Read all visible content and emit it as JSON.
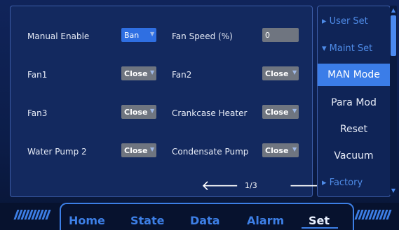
{
  "main": {
    "rows": [
      {
        "left_label": "Manual Enable",
        "left_value": "Ban",
        "right_label": "Fan Speed (%)",
        "right_value": "0"
      },
      {
        "left_label": "Fan1",
        "left_value": "Close",
        "right_label": "Fan2",
        "right_value": "Close"
      },
      {
        "left_label": "Fan3",
        "left_value": "Close",
        "right_label": "Crankcase Heater",
        "right_value": "Close"
      },
      {
        "left_label": "Water Pump 2",
        "left_value": "Close",
        "right_label": "Condensate Pump",
        "right_value": "Close"
      }
    ],
    "pager": {
      "indicator": "1/3"
    }
  },
  "side_menu": {
    "items": [
      {
        "label": "▸ User Set"
      },
      {
        "label": "▾ Maint Set"
      },
      {
        "label": "MAN Mode"
      },
      {
        "label": "Para Mod"
      },
      {
        "label": "Reset"
      },
      {
        "label": "Vacuum"
      },
      {
        "label": "▸ Factory"
      }
    ]
  },
  "tabs": [
    {
      "label": "Home"
    },
    {
      "label": "State"
    },
    {
      "label": "Data"
    },
    {
      "label": "Alarm"
    },
    {
      "label": "Set"
    }
  ],
  "colors": {
    "accent": "#3d7fe6",
    "active_menu": "#3b7de8",
    "dropdown_grey": "#6f7580",
    "dropdown_blue": "#2f6fe2"
  }
}
